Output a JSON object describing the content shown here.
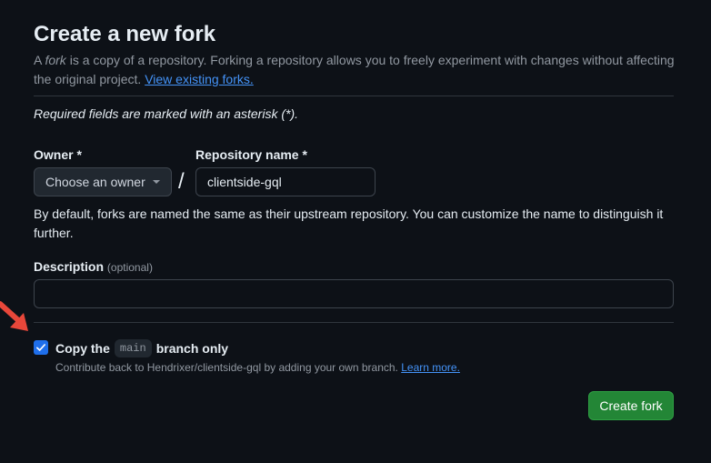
{
  "header": {
    "title": "Create a new fork",
    "intro_prefix": "A ",
    "intro_em": "fork",
    "intro_suffix": " is a copy of a repository. Forking a repository allows you to freely experiment with changes without affecting the original project. ",
    "intro_link": "View existing forks."
  },
  "form": {
    "required_note": "Required fields are marked with an asterisk (*).",
    "owner": {
      "label": "Owner *",
      "selected": "Choose an owner"
    },
    "separator": "/",
    "repo_name": {
      "label": "Repository name *",
      "value": "clientside-gql"
    },
    "naming_hint": "By default, forks are named the same as their upstream repository. You can customize the name to distinguish it further.",
    "description": {
      "label": "Description",
      "optional": "(optional)",
      "value": ""
    },
    "copy_branch": {
      "checked": true,
      "label_prefix": "Copy the",
      "branch": "main",
      "label_suffix": "branch only",
      "sub_text": "Contribute back to Hendrixer/clientside-gql by adding your own branch. ",
      "sub_link": "Learn more."
    },
    "submit_label": "Create fork"
  },
  "colors": {
    "background": "#0d1117",
    "accent_link": "#4493f8",
    "primary_button": "#238636",
    "checkbox": "#1f6feb",
    "annotation_arrow": "#e8473a"
  },
  "icons": {
    "owner_caret": "chevron-down-icon",
    "checkbox_mark": "checkmark-icon",
    "annotation": "red-arrow-icon"
  }
}
